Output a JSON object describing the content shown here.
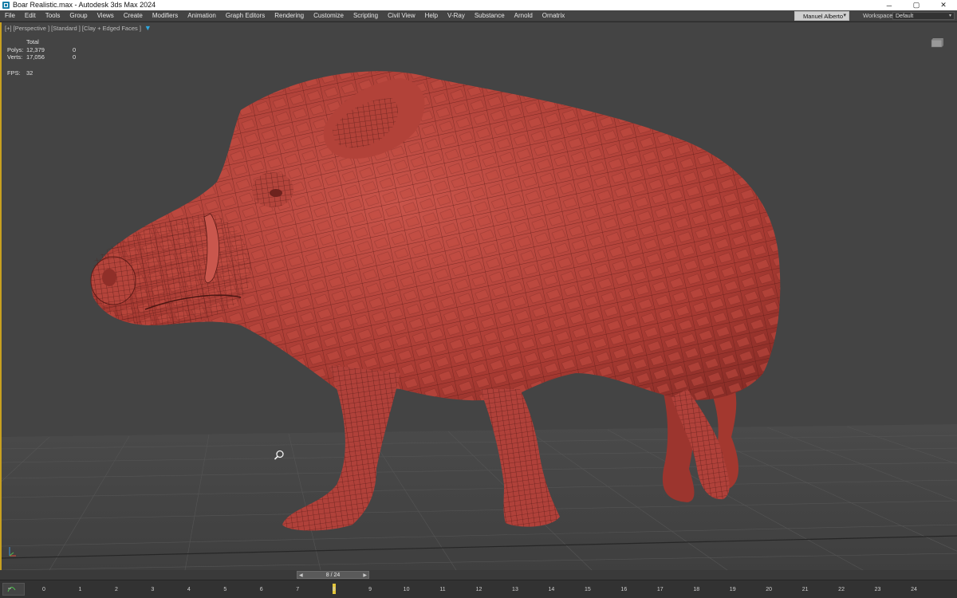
{
  "window": {
    "title": "Boar Realistic.max - Autodesk 3ds Max 2024",
    "controls": [
      "─",
      "▢",
      "✕"
    ]
  },
  "menu": {
    "items": [
      "File",
      "Edit",
      "Tools",
      "Group",
      "Views",
      "Create",
      "Modifiers",
      "Animation",
      "Graph Editors",
      "Rendering",
      "Customize",
      "Scripting",
      "Civil View",
      "Help",
      "V-Ray",
      "Substance",
      "Arnold",
      "Ornatrix"
    ],
    "user": "Manuel Alberto",
    "workspaces_label": "Workspaces:",
    "workspace_value": "Default"
  },
  "viewport": {
    "label": "[+] [Perspective ] [Standard ] [Clay + Edged Faces ]",
    "stats": {
      "header": "Total",
      "polys_label": "Polys:",
      "polys_total": "12,379",
      "polys_sel": "0",
      "verts_label": "Verts:",
      "verts_total": "17,056",
      "verts_sel": "0",
      "fps_label": "FPS:",
      "fps_value": "32"
    },
    "model_color": "#b8433a",
    "background_color": "#444444"
  },
  "timeline": {
    "frame_display": "8 / 24",
    "current_frame": 8,
    "ticks": [
      "0",
      "1",
      "2",
      "3",
      "4",
      "5",
      "6",
      "7",
      "8",
      "9",
      "10",
      "11",
      "12",
      "13",
      "14",
      "15",
      "16",
      "17",
      "18",
      "19",
      "20",
      "21",
      "22",
      "23",
      "24"
    ]
  }
}
